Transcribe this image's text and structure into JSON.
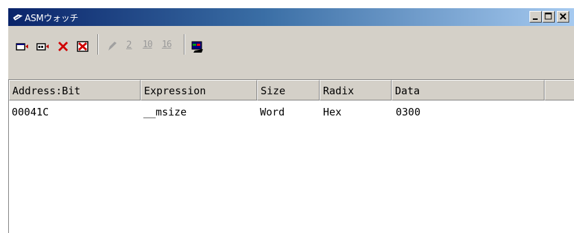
{
  "window": {
    "title": "ASMウォッチ"
  },
  "toolbar": {
    "icons": [
      "add-watch-icon",
      "add-watch-alt-icon",
      "delete-icon",
      "delete-all-icon",
      "edit-icon",
      "radix-2-icon",
      "radix-10-icon",
      "radix-16-icon",
      "settings-icon"
    ],
    "radix_labels": {
      "bin": "2",
      "dec": "10",
      "hex": "16"
    }
  },
  "table": {
    "columns": [
      "Address:Bit",
      "Expression",
      "Size",
      "Radix",
      "Data",
      ""
    ],
    "rows": [
      {
        "address": "00041C",
        "expression": "__msize",
        "size": "Word",
        "radix": "Hex",
        "data": "0300"
      }
    ]
  }
}
